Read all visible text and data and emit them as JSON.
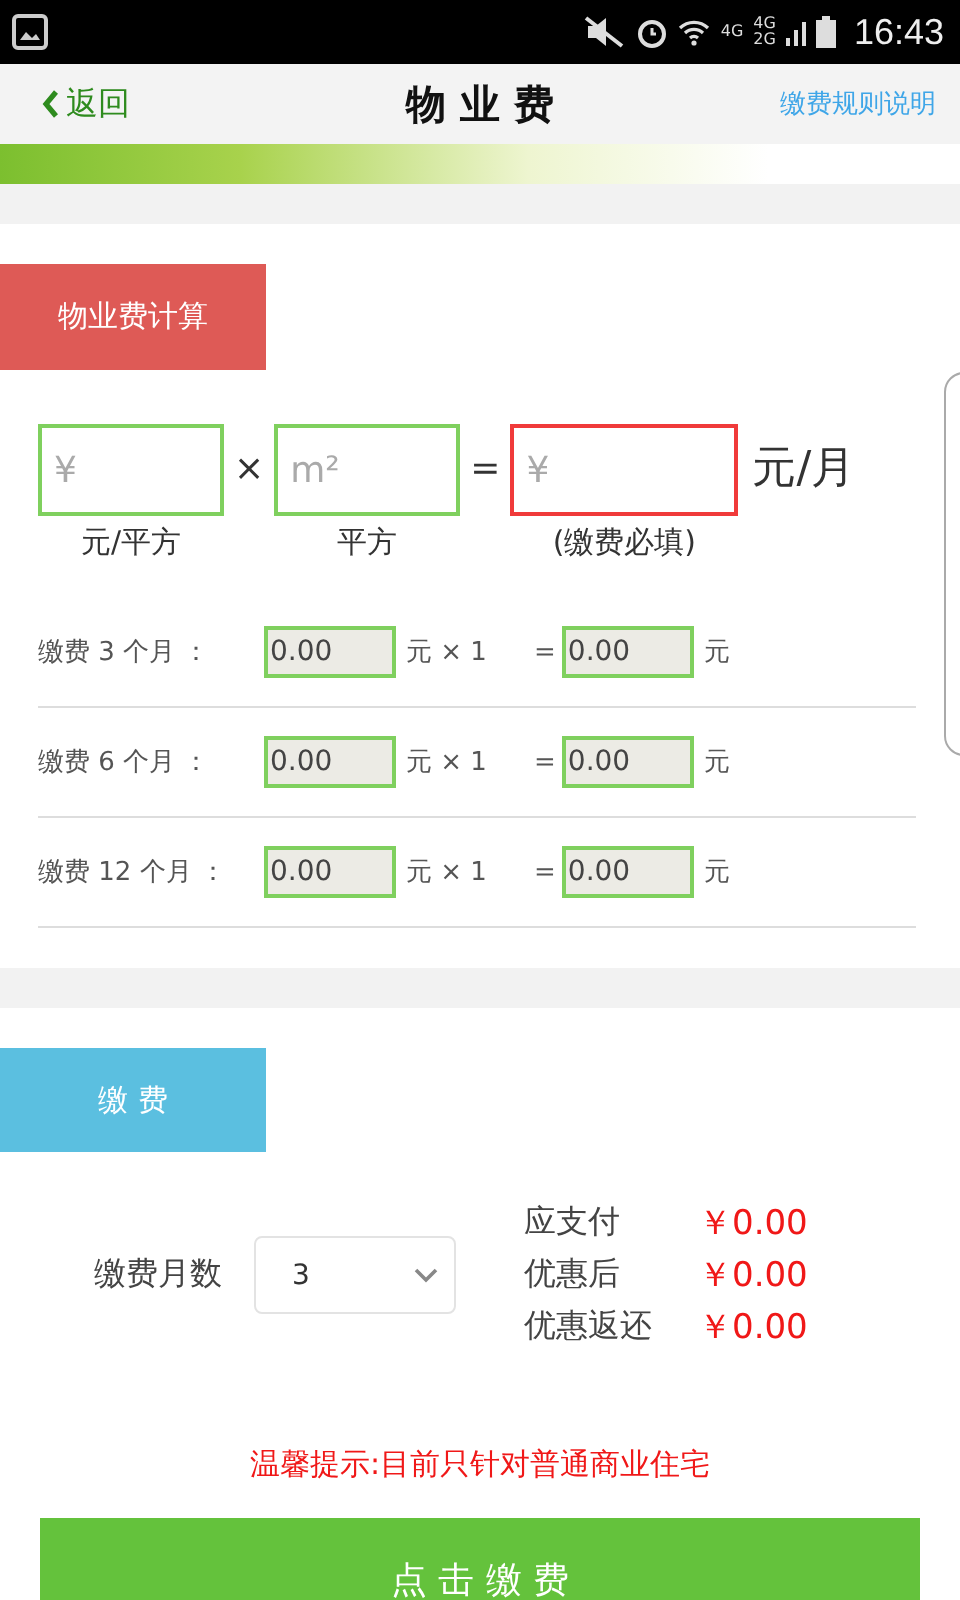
{
  "status_bar": {
    "time": "16:43",
    "network_1": "4G",
    "network_2": "4G",
    "network_3": "2G"
  },
  "nav": {
    "back": "返回",
    "title": "物 业 费",
    "link": "缴费规则说明"
  },
  "calc": {
    "heading": "物业费计算",
    "unit_price": {
      "placeholder": "¥",
      "caption": "元/平方"
    },
    "times": "×",
    "area": {
      "placeholder": "m²",
      "caption": "平方"
    },
    "equals": "=",
    "monthly": {
      "placeholder": "¥",
      "caption": "(缴费必填)",
      "required": true
    },
    "unit": "元/月",
    "rows": [
      {
        "label": "缴费 3 个月 ：",
        "value": "0.00",
        "multiplier": "元 × 1",
        "equals": "=",
        "total": "0.00",
        "unit": "元"
      },
      {
        "label": "缴费 6 个月 ：",
        "value": "0.00",
        "multiplier": "元 × 1",
        "equals": "=",
        "total": "0.00",
        "unit": "元"
      },
      {
        "label": "缴费 12 个月 ：",
        "value": "0.00",
        "multiplier": "元 × 1",
        "equals": "=",
        "total": "0.00",
        "unit": "元"
      }
    ]
  },
  "pay": {
    "heading": "缴 费",
    "months_label": "缴费月数",
    "months_value": "3",
    "summary": [
      {
        "label": "应支付",
        "amount": "￥0.00"
      },
      {
        "label": "优惠后",
        "amount": "￥0.00"
      },
      {
        "label": "优惠返还",
        "amount": "￥0.00"
      }
    ],
    "tip": "温馨提示:目前只针对普通商业住宅",
    "button": "点 击 缴 费"
  }
}
